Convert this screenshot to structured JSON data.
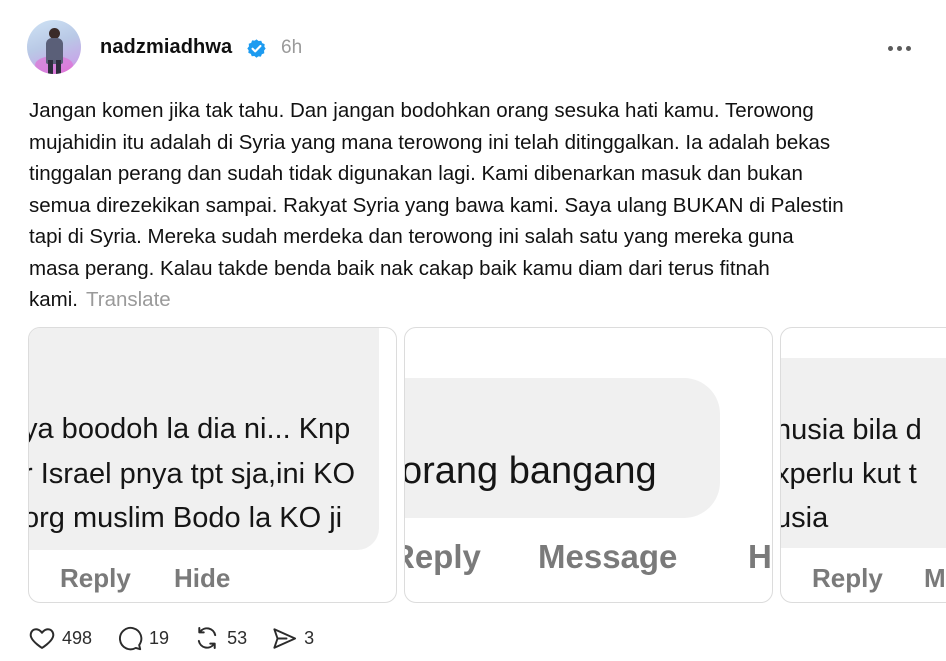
{
  "post": {
    "username": "nadzmiadhwa",
    "timestamp": "6h",
    "text_lines": [
      "Jangan komen jika tak tahu. Dan jangan bodohkan orang sesuka hati kamu. Terowong",
      "mujahidin itu adalah di Syria yang mana terowong ini telah ditinggalkan. Ia adalah bekas",
      "tinggalan perang dan sudah tidak digunakan lagi. Kami dibenarkan masuk dan bukan",
      "semua direzekikan sampai. Rakyat Syria yang bawa kami. Saya ulang BUKAN di Palestin",
      "tapi di Syria. Mereka sudah merdeka dan terowong ini salah satu yang mereka guna",
      "masa perang. Kalau takde benda baik nak cakap baik kamu diam dari terus fitnah",
      "kami."
    ],
    "translate_label": "Translate"
  },
  "media": {
    "card1": {
      "lines": [
        "ya boodoh la dia ni... Knp",
        "r Israel pnya tpt sja,ini KO",
        "org muslim Bodo la KO ji"
      ],
      "reply": "Reply",
      "hide": "Hide"
    },
    "card2": {
      "text": "orang bangang",
      "reply": "Reply",
      "message": "Message",
      "extra": "H"
    },
    "card3": {
      "lines": [
        "nusia bila d",
        "xperlu kut t",
        "usia"
      ],
      "reply": "Reply",
      "extra": "M"
    }
  },
  "actions": {
    "likes": "498",
    "comments": "19",
    "reposts": "53",
    "shares": "3"
  },
  "colors": {
    "verified": "#1d9bf0",
    "muted": "#9a9a9a"
  }
}
